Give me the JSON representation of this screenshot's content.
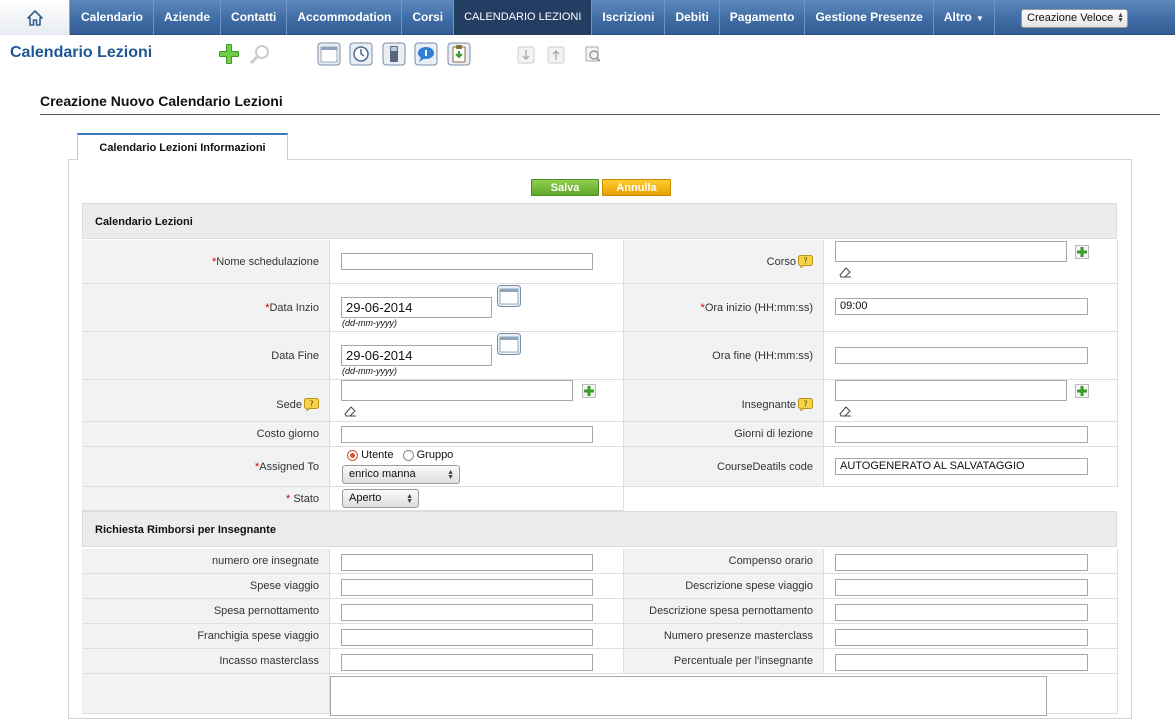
{
  "nav": {
    "items": [
      "Calendario",
      "Aziende",
      "Contatti",
      "Accommodation",
      "Corsi",
      "CALENDARIO LEZIONI",
      "Iscrizioni",
      "Debiti",
      "Pagamento",
      "Gestione Presenze",
      "Altro"
    ],
    "active_index": 5,
    "quick_create": "Creazione Veloce"
  },
  "page": {
    "title": "Calendario Lezioni"
  },
  "form": {
    "heading": "Creazione Nuovo Calendario Lezioni",
    "tab": "Calendario Lezioni Informazioni",
    "save_label": "Salva",
    "cancel_label": "Annulla",
    "section1": {
      "title": "Calendario Lezioni",
      "nome_label": "Nome schedulazione",
      "corso_label": "Corso",
      "data_inizio_label": "Data Inzio",
      "data_inizio_value": "29-06-2014",
      "date_hint": "(dd-mm-yyyy)",
      "ora_inizio_label": "Ora inizio (HH:mm:ss)",
      "ora_inizio_value": "09:00",
      "data_fine_label": "Data Fine",
      "data_fine_value": "29-06-2014",
      "ora_fine_label": "Ora fine (HH:mm:ss)",
      "sede_label": "Sede",
      "insegnante_label": "Insegnante",
      "costo_label": "Costo giorno",
      "giorni_label": "Giorni di lezione",
      "assigned_label": "Assigned To",
      "radio_user": "Utente",
      "radio_group": "Gruppo",
      "assigned_value": "enrico manna",
      "coursedetails_label": "CourseDeatils code",
      "coursedetails_value": "AUTOGENERATO AL SALVATAGGIO",
      "stato_label": "Stato",
      "stato_value": "Aperto",
      "required_mark": "*"
    },
    "section2": {
      "title": "Richiesta Rimborsi per Insegnante",
      "rows": [
        {
          "left": "numero ore insegnate",
          "right": "Compenso orario"
        },
        {
          "left": "Spese viaggio",
          "right": "Descrizione spese viaggio"
        },
        {
          "left": "Spesa pernottamento",
          "right": "Descrizione spesa pernottamento"
        },
        {
          "left": "Franchigia spese viaggio",
          "right": "Numero presenze masterclass"
        },
        {
          "left": "Incasso masterclass",
          "right": "Percentuale per l'insegnante"
        }
      ]
    }
  },
  "colors": {
    "nav": "#3e6ba3",
    "nav_active": "#233d63",
    "title": "#1f5796",
    "save": "#6cb334",
    "cancel": "#f0b000",
    "required": "#cc0000"
  }
}
